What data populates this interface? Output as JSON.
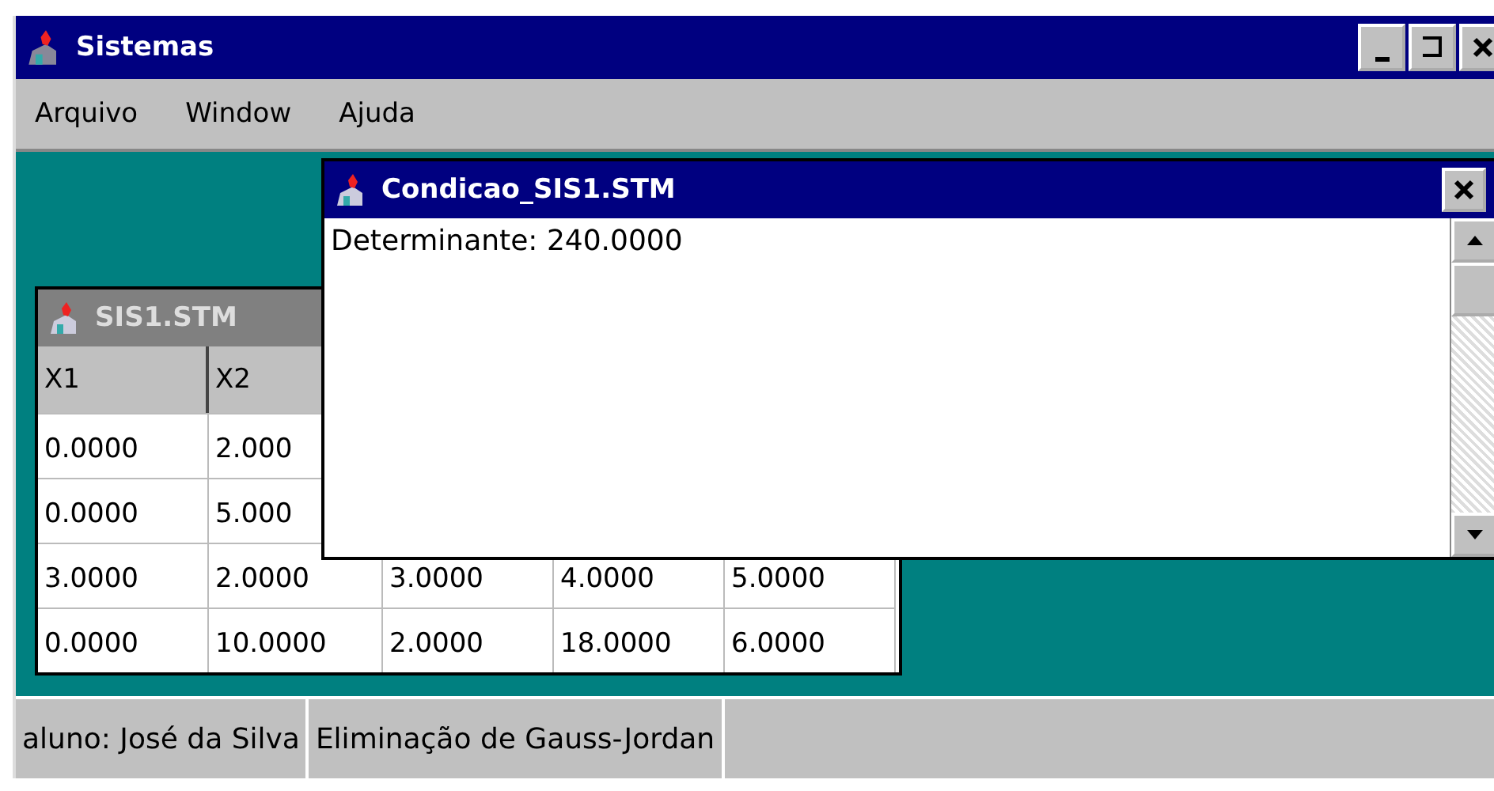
{
  "window": {
    "title": "Sistemas"
  },
  "menu": [
    "Arquivo",
    "Window",
    "Ajuda"
  ],
  "table_window": {
    "title": "SIS1.STM",
    "active": false,
    "columns": [
      "X1",
      "X2"
    ],
    "rows": [
      [
        "0.0000",
        "2.000"
      ],
      [
        "0.0000",
        "5.000"
      ],
      [
        "3.0000",
        "2.0000",
        "3.0000",
        "4.0000",
        "5.0000"
      ],
      [
        "0.0000",
        "10.0000",
        "2.0000",
        "18.0000",
        "6.0000"
      ]
    ]
  },
  "dialog": {
    "title": "Condicao_SIS1.STM",
    "active": true,
    "text": "Determinante: 240.0000"
  },
  "status_bar": [
    "aluno: José da Silva",
    "Eliminação de Gauss-Jordan"
  ]
}
